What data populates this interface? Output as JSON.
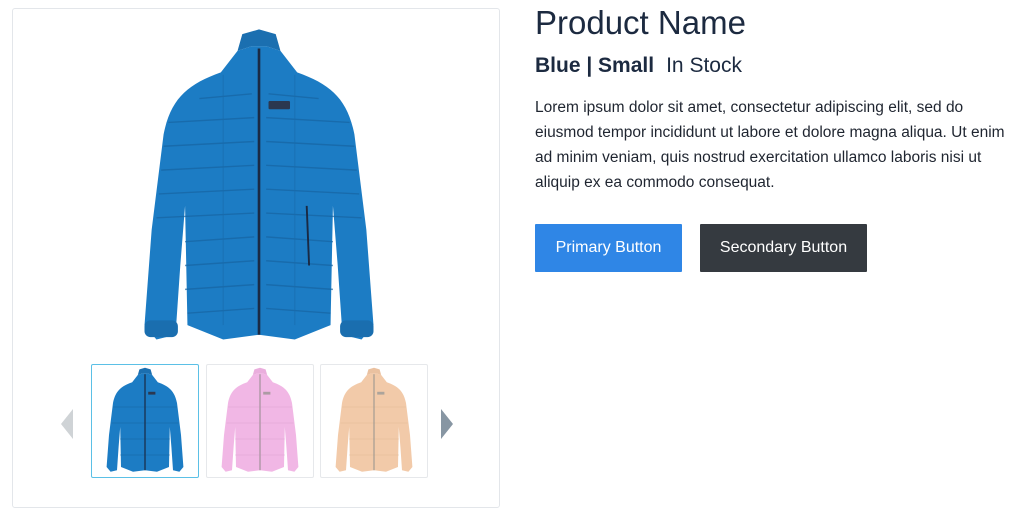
{
  "product": {
    "name": "Product Name",
    "variant": "Blue | Small",
    "stock_status": "In Stock",
    "description": "Lorem ipsum dolor sit amet, consectetur adipiscing elit, sed do eiusmod tempor incididunt ut labore et dolore magna aliqua. Ut enim ad minim veniam, quis nostrud exercitation ullamco laboris nisi ut aliquip ex ea commodo consequat."
  },
  "buttons": {
    "primary_label": "Primary Button",
    "secondary_label": "Secondary Button"
  },
  "gallery": {
    "selected_color": "blue",
    "thumbnails": [
      {
        "color_name": "blue",
        "color": "#1c7cc4",
        "selected": true
      },
      {
        "color_name": "pink",
        "color": "#e77ed0",
        "selected": false
      },
      {
        "color_name": "orange",
        "color": "#e8a064",
        "selected": false
      }
    ]
  },
  "colors": {
    "primary": "#2f86e6",
    "secondary": "#353a40",
    "active_thumb_border": "#5bc0e6",
    "arrow_left": "#cfd3d6",
    "arrow_right": "#8796a3"
  },
  "icons": {
    "prev": "chevron-left-icon",
    "next": "chevron-right-icon"
  }
}
